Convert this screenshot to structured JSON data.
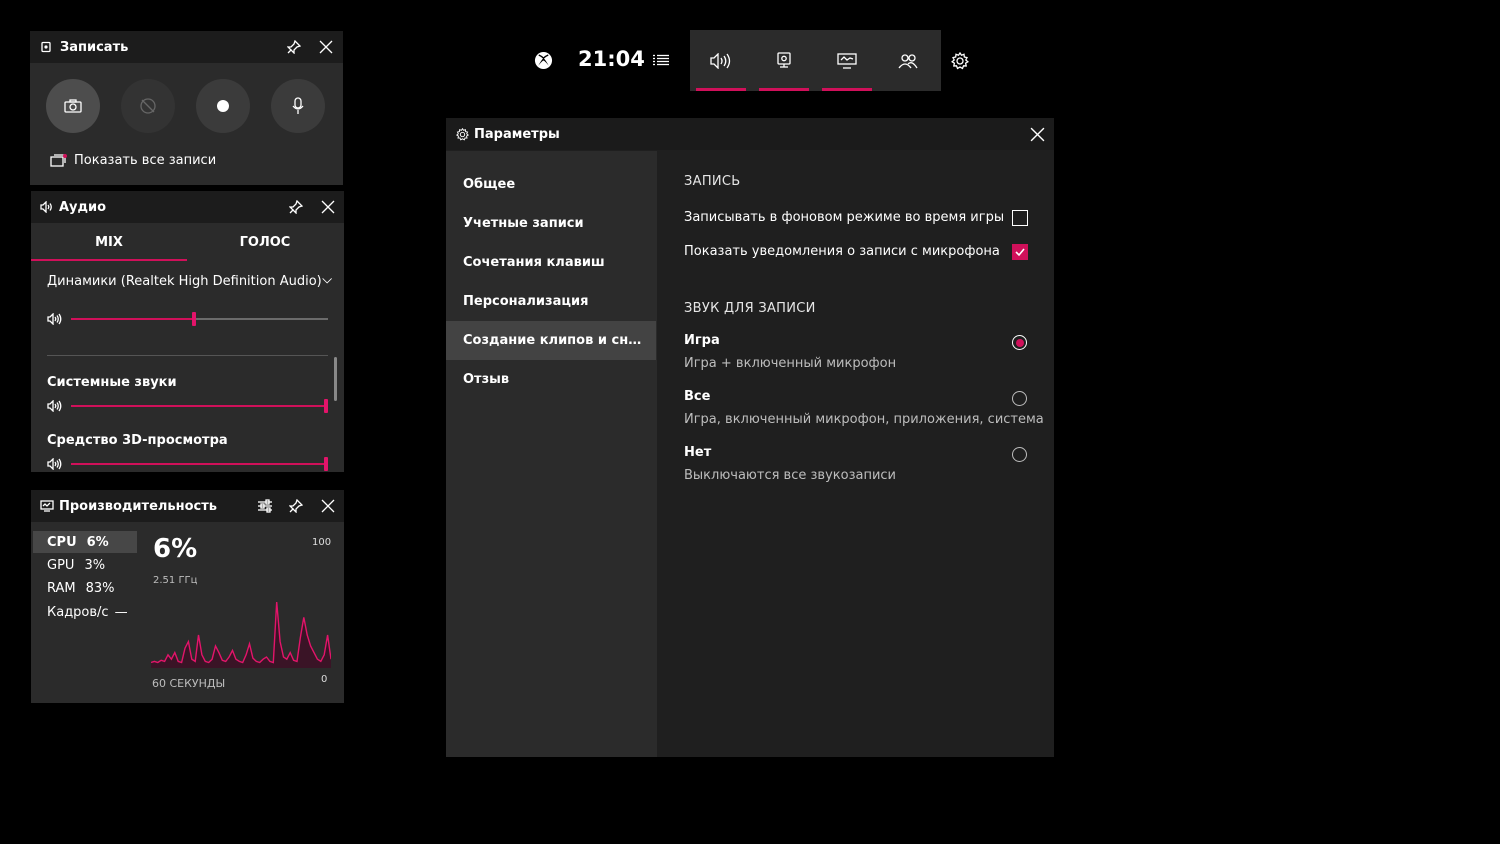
{
  "record_widget": {
    "title": "Записать",
    "show_all_label": "Показать все записи"
  },
  "audio_widget": {
    "title": "Аудио",
    "tabs": [
      "MIX",
      "ГОЛОС"
    ],
    "device": "Динамики (Realtek High Definition Audio)",
    "master_level": 0.48,
    "apps": [
      {
        "name": "Системные звуки",
        "level": 1.0
      },
      {
        "name": "Средство 3D-просмотра",
        "level": 1.0
      }
    ]
  },
  "perf_widget": {
    "title": "Производительность",
    "stats": [
      {
        "label": "CPU",
        "value": "6%"
      },
      {
        "label": "GPU",
        "value": "3%"
      },
      {
        "label": "RAM",
        "value": "83%"
      },
      {
        "label": "Кадров/с",
        "value": "—"
      }
    ],
    "big_value": "6%",
    "freq": "2.51 ГГц",
    "y_max": "100",
    "y_min": "0",
    "x_label": "60 СЕКУНДЫ",
    "cpu_history": [
      5,
      6,
      5,
      7,
      6,
      12,
      8,
      14,
      6,
      5,
      18,
      24,
      8,
      6,
      30,
      12,
      6,
      5,
      8,
      20,
      14,
      7,
      6,
      10,
      16,
      8,
      6,
      5,
      12,
      22,
      9,
      6,
      5,
      8,
      10,
      6,
      5,
      60,
      24,
      10,
      8,
      14,
      7,
      6,
      28,
      46,
      30,
      20,
      14,
      8,
      6,
      12,
      30,
      8
    ]
  },
  "topbar": {
    "time": "21:04",
    "buttons": [
      "audio-icon",
      "capture-icon",
      "performance-icon",
      "social-icon"
    ]
  },
  "settings": {
    "title": "Параметры",
    "nav": [
      "Общее",
      "Учетные записи",
      "Сочетания клавиш",
      "Персонализация",
      "Создание клипов и снимк...",
      "Отзыв"
    ],
    "selected_nav": 4,
    "section_record": "ЗАПИСЬ",
    "opt_background": "Записывать в фоновом режиме во время игры",
    "opt_background_checked": false,
    "opt_mic_notify": "Показать уведомления о записи с микрофона",
    "opt_mic_notify_checked": true,
    "section_audio": "ЗВУК ДЛЯ ЗАПИСИ",
    "audio_options": [
      {
        "title": "Игра",
        "desc": "Игра + включенный микрофон",
        "selected": true
      },
      {
        "title": "Все",
        "desc": "Игра, включенный микрофон, приложения, система",
        "selected": false
      },
      {
        "title": "Нет",
        "desc": "Выключаются все звукозаписи",
        "selected": false
      }
    ],
    "accent": "#d0105a"
  }
}
